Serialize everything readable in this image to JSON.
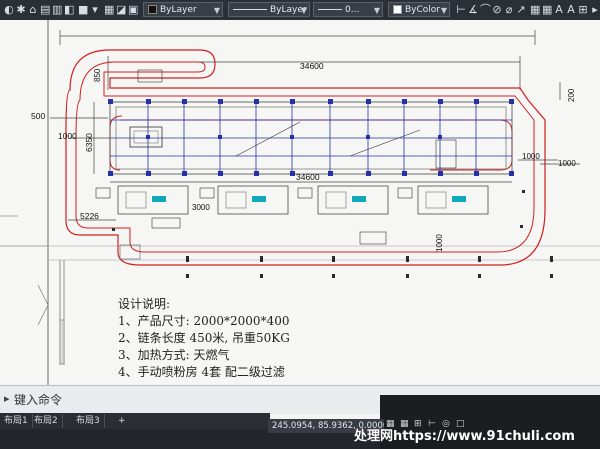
{
  "ribbon": {
    "layer_value": "ByLayer",
    "linetype_value": "ByLayer",
    "lineweight_value": "0...",
    "color_value": "ByColor"
  },
  "drawing": {
    "dimensions": {
      "top_overall": "34600",
      "inner_top": "34600",
      "middle": "34600",
      "left_500": "500",
      "left_1000": "1000",
      "left_6350": "6350",
      "left_850": "850",
      "right_200": "200",
      "right_1000": "1000",
      "right_1000_b": "1000",
      "bottom_5226": "5226",
      "bottom_3000": "3000",
      "bottom_1000": "1000"
    },
    "notes": {
      "title": "设计说明:",
      "line1": "1、产品尺寸:  2000*2000*400",
      "line2": "2、链条长度 450米, 吊重50KG",
      "line3": "3、加热方式: 天燃气",
      "line4": "4、手动喷粉房 4套 配二级过滤"
    }
  },
  "command": {
    "prompt": "键入命令"
  },
  "layout_tabs": [
    "布局1",
    "布局2",
    "布局3"
  ],
  "status": {
    "coordinates": "245.0954, 85.9362, 0.0000"
  },
  "watermark": "处理网https://www.91chuli.com",
  "colors": {
    "layout_red": "#d21f1f",
    "grid_blue": "#2630a8",
    "equipment_cyan": "#10a9b9"
  }
}
